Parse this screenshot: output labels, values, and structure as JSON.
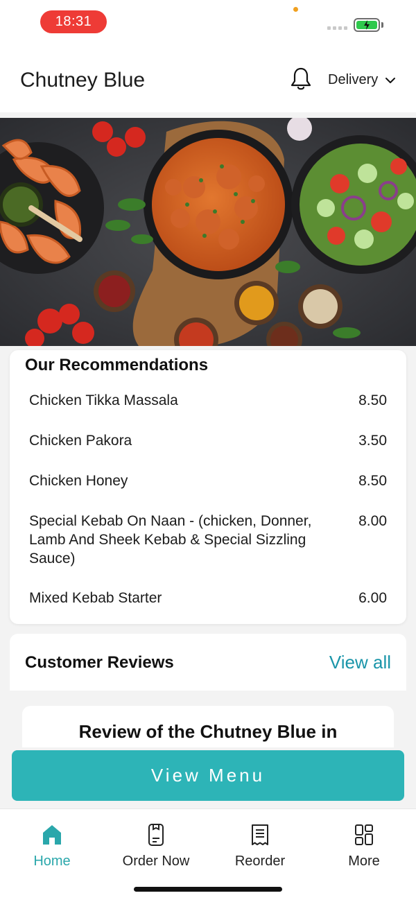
{
  "status_bar": {
    "time": "18:31",
    "battery_icon": "battery-charging-icon",
    "colors": {
      "time_pill": "#ee3b36",
      "battery": "#2fc94d"
    }
  },
  "header": {
    "title": "Chutney Blue",
    "notification_icon": "bell-icon",
    "delivery_label": "Delivery",
    "dropdown_icon": "chevron-down-icon"
  },
  "hero": {
    "image_alt": "Food banner: shrimp, chicken curry, salad and spices"
  },
  "recommendations": {
    "title": "Our Recommendations",
    "items": [
      {
        "name": "Chicken Tikka Massala",
        "price": "8.50"
      },
      {
        "name": "Chicken Pakora",
        "price": "3.50"
      },
      {
        "name": "Chicken Honey",
        "price": "8.50"
      },
      {
        "name": "Special Kebab On Naan - (chicken, Donner, Lamb And Sheek Kebab & Special Sizzling Sauce)",
        "price": "8.00"
      },
      {
        "name": "Mixed Kebab Starter",
        "price": "6.00"
      }
    ]
  },
  "reviews": {
    "title": "Customer Reviews",
    "view_all": "View all",
    "first_review_heading": "Review of the Chutney Blue in"
  },
  "cta": {
    "view_menu": "View Menu"
  },
  "bottom_nav": {
    "items": [
      {
        "label": "Home",
        "icon": "home-icon",
        "active": true
      },
      {
        "label": "Order Now",
        "icon": "phone-order-icon",
        "active": false
      },
      {
        "label": "Reorder",
        "icon": "receipt-icon",
        "active": false
      },
      {
        "label": "More",
        "icon": "grid-icon",
        "active": false
      }
    ]
  },
  "colors": {
    "accent": "#2db4b7",
    "link": "#1a95a9",
    "active_nav": "#2aa7ab",
    "background": "#f3f3f3"
  }
}
